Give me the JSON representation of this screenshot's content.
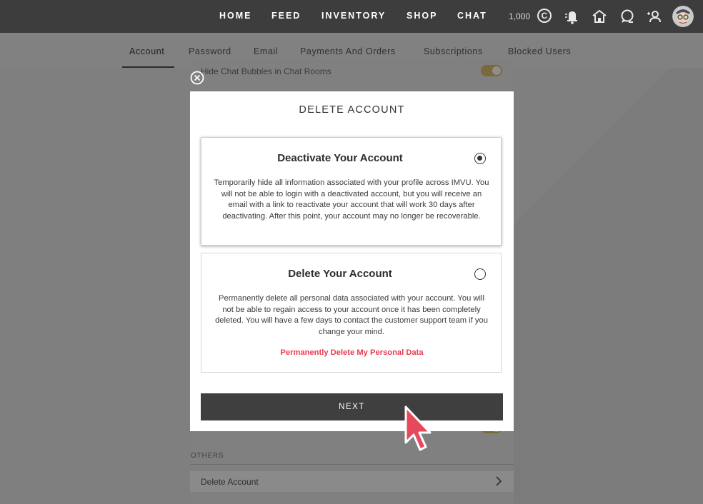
{
  "topnav": {
    "links": [
      "HOME",
      "FEED",
      "INVENTORY",
      "SHOP",
      "CHAT"
    ],
    "credits": "1,000",
    "credit_symbol": "C",
    "icons": [
      "notifications-icon",
      "home-icon",
      "messages-icon",
      "friends-icon"
    ]
  },
  "tabs": [
    "Account",
    "Password",
    "Email",
    "Payments And Orders",
    "Subscriptions",
    "Blocked Users"
  ],
  "active_tab": "Account",
  "settings": {
    "hide_chat_bubbles_label": "Hide Chat Bubbles in Chat Rooms"
  },
  "others": {
    "section_label": "OTHERS",
    "delete_account_label": "Delete Account"
  },
  "modal": {
    "title": "DELETE ACCOUNT",
    "options": [
      {
        "title": "Deactivate Your Account",
        "selected": true,
        "body": "Temporarily hide all information associated with your profile across IMVU. You will not be able to login with a deactivated account, but you will receive an email with a link to reactivate your account that will work 30 days after deactivating. After this point, your account may no longer be recoverable."
      },
      {
        "title": "Delete Your Account",
        "selected": false,
        "body": "Permanently delete all personal data associated with your account. You will not be able to regain access to your account once it has been completely deleted. You will have a few days to contact the customer support team if you change your mind.",
        "link": "Permanently Delete My Personal Data"
      }
    ],
    "next_label": "NEXT"
  },
  "colors": {
    "topbar": "#3d3d3d",
    "overlay": "#7f7f7f",
    "danger": "#e83a4e",
    "button": "#3f3f3f",
    "cursor": "#e8485c"
  }
}
